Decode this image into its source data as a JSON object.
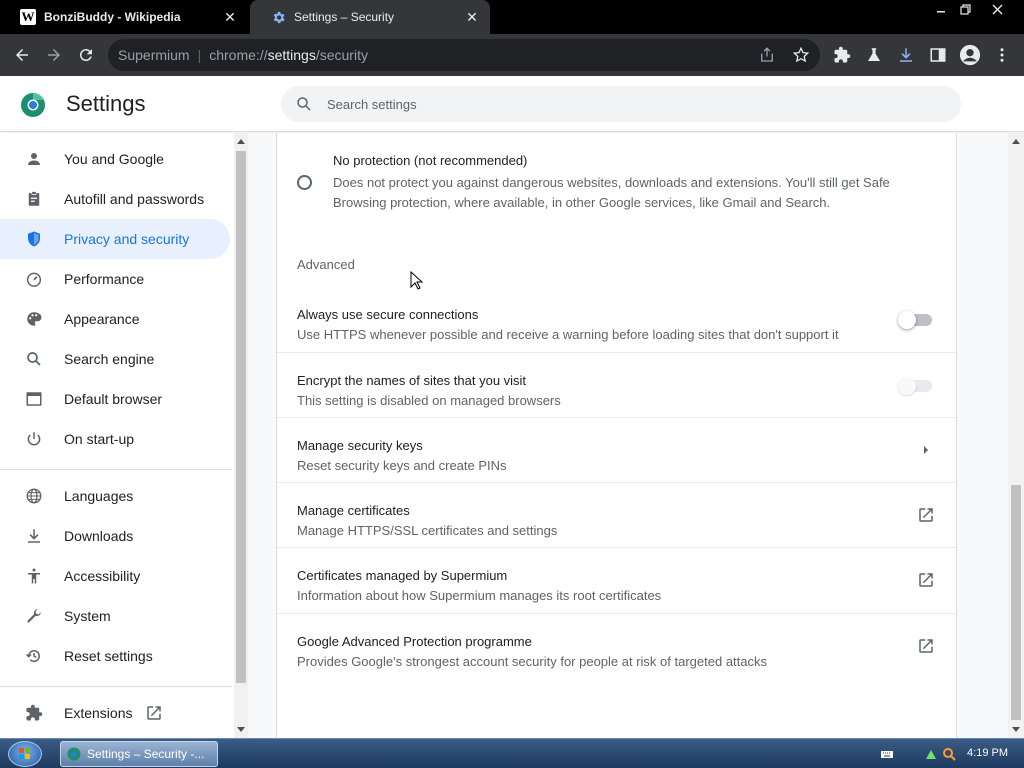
{
  "browser": {
    "tabs": [
      {
        "title": "BonziBuddy - Wikipedia",
        "active": false,
        "favicon": "wikipedia-icon"
      },
      {
        "title": "Settings – Security",
        "active": true,
        "favicon": "settings-gear-icon"
      }
    ],
    "window_controls": {
      "minimize": "minimize-icon",
      "restore": "restore-icon",
      "close": "close-icon"
    },
    "omnibox": {
      "chip": "Supermium",
      "url_prefix": "chrome://",
      "url_host": "settings",
      "url_path": "/security"
    }
  },
  "settings": {
    "title": "Settings",
    "search_placeholder": "Search settings"
  },
  "sidebar": {
    "items": [
      {
        "label": "You and Google",
        "icon": "person-icon",
        "active": false
      },
      {
        "label": "Autofill and passwords",
        "icon": "clipboard-icon",
        "active": false
      },
      {
        "label": "Privacy and security",
        "icon": "shield-icon",
        "active": true
      },
      {
        "label": "Performance",
        "icon": "speedometer-icon",
        "active": false
      },
      {
        "label": "Appearance",
        "icon": "palette-icon",
        "active": false
      },
      {
        "label": "Search engine",
        "icon": "search-icon",
        "active": false
      },
      {
        "label": "Default browser",
        "icon": "browser-window-icon",
        "active": false
      },
      {
        "label": "On start-up",
        "icon": "power-icon",
        "active": false
      },
      {
        "label": "Languages",
        "icon": "globe-icon",
        "active": false
      },
      {
        "label": "Downloads",
        "icon": "download-icon",
        "active": false
      },
      {
        "label": "Accessibility",
        "icon": "accessibility-icon",
        "active": false
      },
      {
        "label": "System",
        "icon": "wrench-icon",
        "active": false
      },
      {
        "label": "Reset settings",
        "icon": "restore-history-icon",
        "active": false
      },
      {
        "label": "Extensions",
        "icon": "puzzle-icon",
        "active": false
      }
    ]
  },
  "content": {
    "radio_option": {
      "title": "No protection (not recommended)",
      "description": "Does not protect you against dangerous websites, downloads and extensions. You'll still get Safe Browsing protection, where available, in other Google services, like Gmail and Search.",
      "selected": false
    },
    "advanced_heading": "Advanced",
    "rows": [
      {
        "title": "Always use secure connections",
        "description": "Use HTTPS whenever possible and receive a warning before loading sites that don't support it",
        "control": "toggle",
        "state": "off"
      },
      {
        "title": "Encrypt the names of sites that you visit",
        "description": "This setting is disabled on managed browsers",
        "control": "toggle",
        "state": "disabled"
      },
      {
        "title": "Manage security keys",
        "description": "Reset security keys and create PINs",
        "control": "chevron-right-icon"
      },
      {
        "title": "Manage certificates",
        "description": "Manage HTTPS/SSL certificates and settings",
        "control": "open-in-new-icon"
      },
      {
        "title": "Certificates managed by Supermium",
        "description": "Information about how Supermium manages its root certificates",
        "control": "open-in-new-icon"
      },
      {
        "title": "Google Advanced Protection programme",
        "description": "Provides Google's strongest account security for people at risk of targeted attacks",
        "control": "open-in-new-icon"
      }
    ]
  },
  "taskbar": {
    "task_label": "Settings – Security -...",
    "clock": "4:19 PM"
  },
  "colors": {
    "accent": "#1a73e8",
    "active_nav_bg": "#e8f0fe",
    "titlebar": "#000000",
    "toolbar": "#35363a",
    "download_icon": "#8ab4f8"
  }
}
